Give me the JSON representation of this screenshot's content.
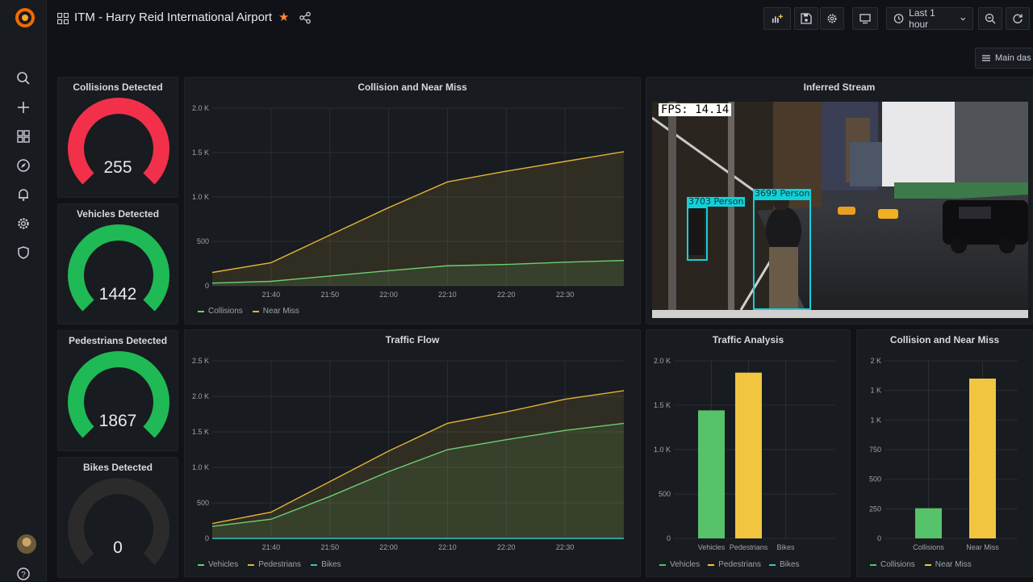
{
  "sidebar": {
    "logo": "grafana-logo",
    "items": [
      {
        "name": "search-icon"
      },
      {
        "name": "plus-icon"
      },
      {
        "name": "dashboards-icon"
      },
      {
        "name": "explore-icon"
      },
      {
        "name": "alerting-bell-icon"
      },
      {
        "name": "settings-gear-icon"
      },
      {
        "name": "shield-icon"
      }
    ],
    "help_icon": "help-icon"
  },
  "header": {
    "title": "ITM - Harry Reid International Airport",
    "starred": true,
    "time_range": "Last 1 hour",
    "main_dash_label": "Main das"
  },
  "colors": {
    "background": "#111217",
    "panel": "#181b1f",
    "red": "#f2304a",
    "green": "#1fb955",
    "yellow": "#e0b43a",
    "light_green": "#6ccf72",
    "bar_green": "#56c26a",
    "bar_yellow": "#f2c541",
    "teal": "#36c5c5",
    "gauge_empty": "#2c2b2b"
  },
  "gauges": [
    {
      "title": "Collisions Detected",
      "value": "255",
      "color": "#f2304a",
      "fill": 1
    },
    {
      "title": "Vehicles Detected",
      "value": "1442",
      "color": "#1fb955",
      "fill": 1
    },
    {
      "title": "Pedestrians Detected",
      "value": "1867",
      "color": "#1fb955",
      "fill": 1
    },
    {
      "title": "Bikes Detected",
      "value": "0",
      "color": "#2c2b2b",
      "fill": 0
    }
  ],
  "panels": {
    "collision_near_miss_ts": {
      "title": "Collision and Near Miss",
      "legend": [
        "Collisions",
        "Near Miss"
      ]
    },
    "inferred_stream": {
      "title": "Inferred Stream",
      "fps": "FPS: 14.14",
      "detections": [
        "3699 Person",
        "3703 Person"
      ]
    },
    "traffic_flow": {
      "title": "Traffic Flow",
      "legend": [
        "Vehicles",
        "Pedestrians",
        "Bikes"
      ]
    },
    "traffic_analysis": {
      "title": "Traffic Analysis",
      "legend": [
        "Vehicles",
        "Pedestrians",
        "Bikes"
      ]
    },
    "collision_near_miss_bar": {
      "title": "Collision and Near Miss",
      "legend": [
        "Collisions",
        "Near Miss"
      ]
    }
  },
  "chart_data": [
    {
      "type": "area",
      "title": "Collision and Near Miss",
      "x": [
        "21:37",
        "21:40",
        "21:50",
        "22:00",
        "22:10",
        "22:20",
        "22:30",
        "22:37"
      ],
      "x_ticks": [
        "21:40",
        "21:50",
        "22:00",
        "22:10",
        "22:20",
        "22:30"
      ],
      "y_ticks": [
        "0",
        "500",
        "1.0 K",
        "1.5 K",
        "2.0 K"
      ],
      "ylim": [
        0,
        2000
      ],
      "series": [
        {
          "name": "Collisions",
          "color": "#6ccf72",
          "values": [
            30,
            50,
            110,
            170,
            225,
            240,
            265,
            285
          ]
        },
        {
          "name": "Near Miss",
          "color": "#e0b43a",
          "values": [
            150,
            260,
            570,
            880,
            1170,
            1290,
            1400,
            1510
          ]
        }
      ]
    },
    {
      "type": "area",
      "title": "Traffic Flow",
      "x": [
        "21:37",
        "21:40",
        "21:50",
        "22:00",
        "22:10",
        "22:20",
        "22:30",
        "22:37"
      ],
      "x_ticks": [
        "21:40",
        "21:50",
        "22:00",
        "22:10",
        "22:20",
        "22:30"
      ],
      "y_ticks": [
        "0",
        "500",
        "1.0 K",
        "1.5 K",
        "2.0 K",
        "2.5 K"
      ],
      "ylim": [
        0,
        2500
      ],
      "series": [
        {
          "name": "Vehicles",
          "color": "#6ccf72",
          "values": [
            170,
            270,
            590,
            940,
            1250,
            1390,
            1520,
            1620
          ]
        },
        {
          "name": "Pedestrians",
          "color": "#e0b43a",
          "values": [
            210,
            370,
            800,
            1230,
            1620,
            1780,
            1960,
            2080
          ]
        },
        {
          "name": "Bikes",
          "color": "#36c5c5",
          "values": [
            0,
            0,
            0,
            0,
            0,
            0,
            0,
            0
          ]
        }
      ]
    },
    {
      "type": "bar",
      "title": "Traffic Analysis",
      "categories": [
        "Vehicles",
        "Pedestrians",
        "Bikes"
      ],
      "values": [
        1442,
        1867,
        0
      ],
      "colors": [
        "#56c26a",
        "#f2c541",
        "#36c5c5"
      ],
      "y_ticks": [
        "0",
        "500",
        "1.0 K",
        "1.5 K",
        "2.0 K"
      ],
      "ylim": [
        0,
        2000
      ]
    },
    {
      "type": "bar",
      "title": "Collision and Near Miss",
      "categories": [
        "Collisions",
        "Near Miss"
      ],
      "values": [
        255,
        1350
      ],
      "colors": [
        "#56c26a",
        "#f2c541"
      ],
      "y_ticks": [
        "0",
        "250",
        "500",
        "750",
        "1 K",
        "1 K",
        "2 K"
      ],
      "ylim": [
        0,
        1500
      ]
    }
  ]
}
